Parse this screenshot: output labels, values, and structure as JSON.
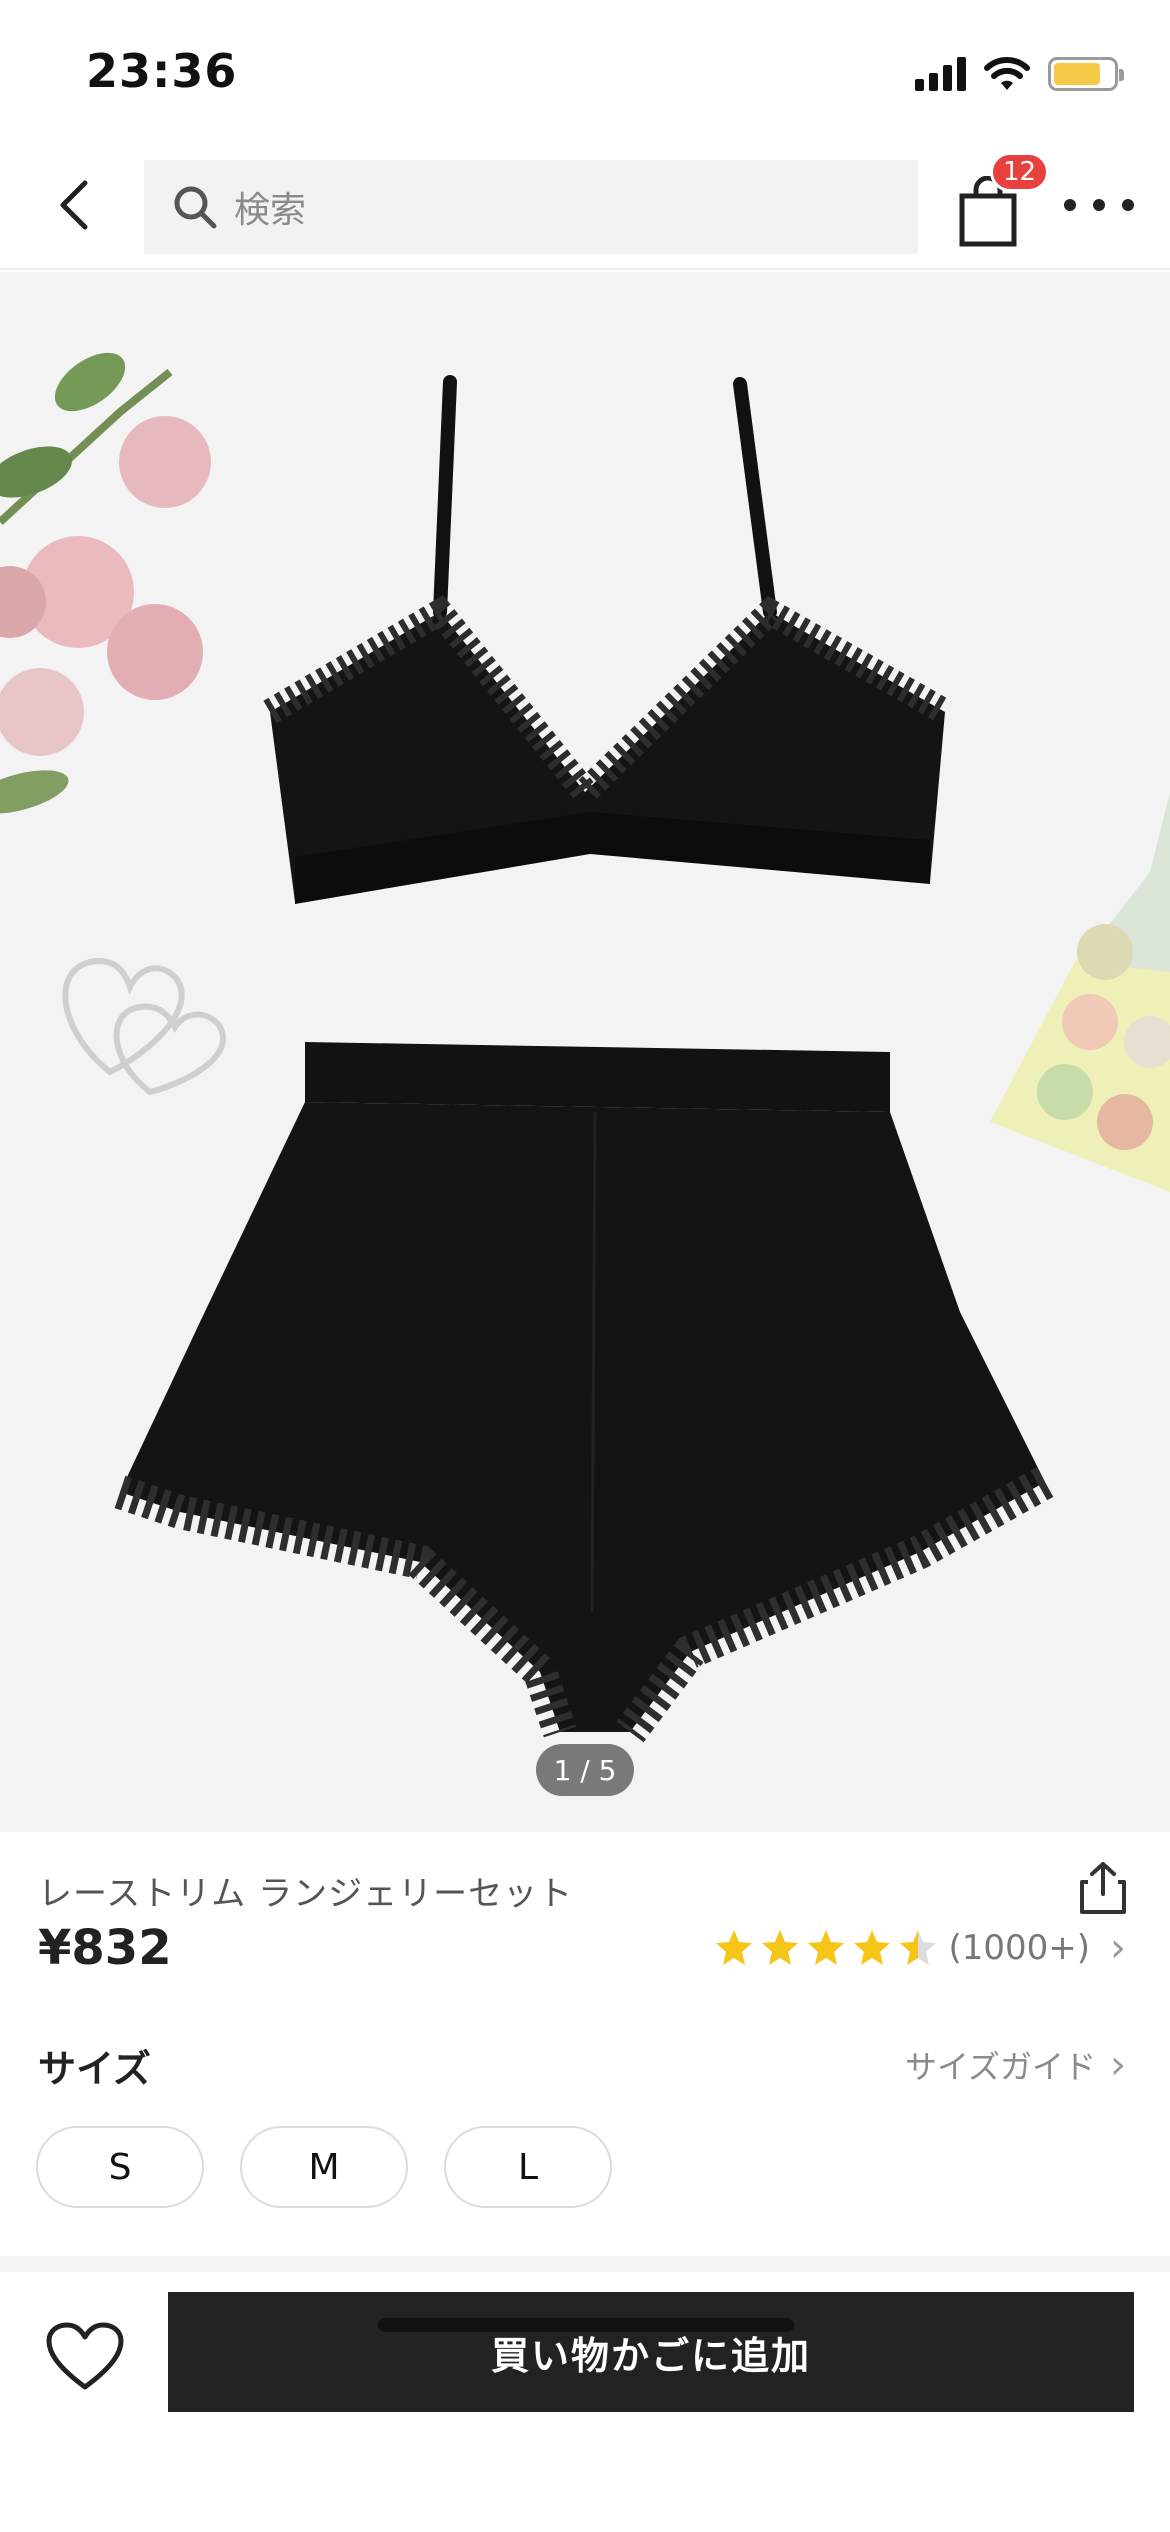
{
  "status_bar": {
    "time": "23:36"
  },
  "nav": {
    "search_placeholder": "検索",
    "cart_badge": "12"
  },
  "gallery": {
    "counter": "1 / 5"
  },
  "product": {
    "title": "レーストリム ランジェリーセット",
    "price": "¥832",
    "rating": 4.5,
    "review_count": "(1000+)"
  },
  "size": {
    "label": "サイズ",
    "guide_label": "サイズガイド",
    "options": [
      "S",
      "M",
      "L"
    ]
  },
  "actions": {
    "add_to_cart_label": "買い物かごに追加"
  },
  "colors": {
    "badge": "#e8403d",
    "star": "#f5c518",
    "primary_button": "#222222",
    "battery": "#f7c948"
  }
}
